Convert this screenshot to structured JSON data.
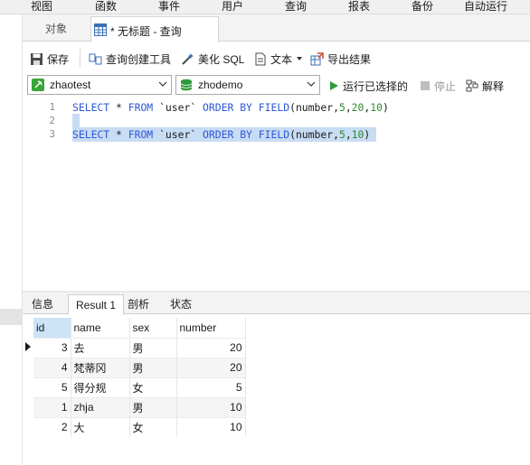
{
  "menu": {
    "items": [
      "视图",
      "函数",
      "事件",
      "用户",
      "查询",
      "报表",
      "备份",
      "自动运行"
    ]
  },
  "tabs": {
    "objects_label": "对象",
    "query_label": "* 无标题 - 查询"
  },
  "toolbar": {
    "save_label": "保存",
    "query_builder_label": "查询创建工具",
    "beautify_label": "美化 SQL",
    "text_label": "文本",
    "export_label": "导出结果"
  },
  "connection": {
    "connection_name": "zhaotest",
    "database_name": "zhodemo",
    "run_selected_label": "运行已选择的",
    "stop_label": "停止",
    "explain_label": "解释"
  },
  "editor": {
    "line_numbers": [
      "1",
      "2",
      "3"
    ],
    "lines": [
      "SELECT * FROM `user` ORDER BY FIELD(number,5,20,10)",
      "",
      "SELECT * FROM `user` ORDER BY FIELD(number,5,10)"
    ]
  },
  "result_tabs": {
    "info": "信息",
    "result1": "Result 1",
    "profile": "剖析",
    "status": "状态"
  },
  "result_table": {
    "columns": [
      "id",
      "name",
      "sex",
      "number"
    ],
    "rows": [
      [
        "3",
        "去",
        "男",
        "20"
      ],
      [
        "4",
        "梵蒂冈",
        "男",
        "20"
      ],
      [
        "5",
        "得分规",
        "女",
        "5"
      ],
      [
        "1",
        "zhja",
        "男",
        "10"
      ],
      [
        "2",
        "大",
        "女",
        "10"
      ]
    ]
  },
  "colors": {
    "keyword": "#2d57d8",
    "number": "#2f8a2f",
    "selection": "#c8dcf3",
    "header_highlight": "#cde3f7"
  }
}
